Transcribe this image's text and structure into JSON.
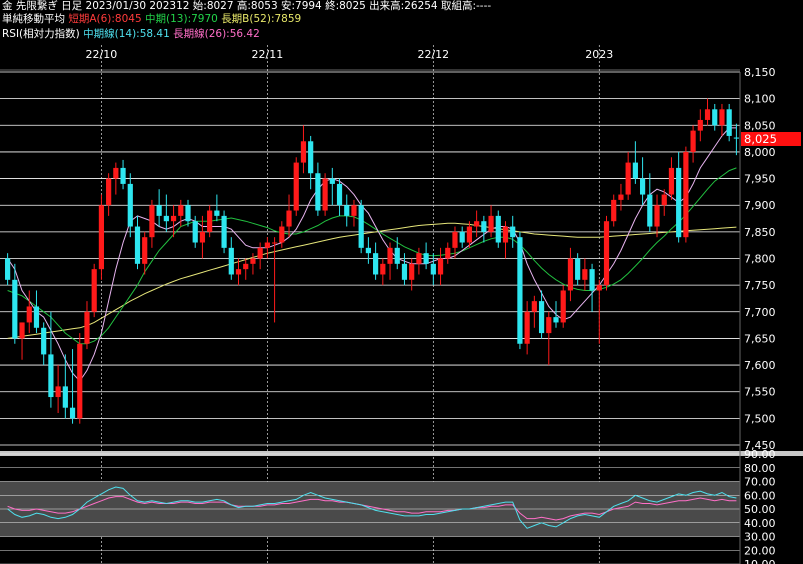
{
  "header": {
    "line1": "金 先限繋ぎ 日足 2023/01/30 202312 始:8027 高:8053 安:7994 終:8025 出来高:26254 取組高:----",
    "ma_title": "単純移動平均",
    "ma_short": "短期A(6):8045",
    "ma_mid": "中期(13):7970",
    "ma_long": "長期B(52):7859",
    "rsi_title": "RSI(相対力指数)",
    "rsi_mid": "中期線(14):58.41",
    "rsi_long": "長期線(26):56.42"
  },
  "current_price_label": "8,025",
  "colors": {
    "up": "#ff1a1a",
    "down": "#2ee6f0",
    "ma_short": "#e8b4f0",
    "ma_mid": "#22c040",
    "ma_long": "#e6e67a",
    "rsi_mid": "#4fe0ee",
    "rsi_long": "#ff6fc8",
    "grid": "#ffffff",
    "band": "#4a4a4a",
    "separator": "#c8c8c8",
    "price_badge": "#ff1010"
  },
  "chart_data": [
    {
      "type": "candlestick",
      "x_ticks": [
        "22/10",
        "22/11",
        "22/12",
        "2023"
      ],
      "x_tick_index": [
        13,
        36,
        59,
        82
      ],
      "ylim": [
        7450,
        8150
      ],
      "yticks": [
        7450,
        7500,
        7550,
        7600,
        7650,
        7700,
        7750,
        7800,
        7850,
        7900,
        7950,
        8000,
        8050,
        8100,
        8150
      ],
      "ytick_labels": [
        "7,450",
        "7,500",
        "7,550",
        "7,600",
        "7,650",
        "7,700",
        "7,750",
        "7,800",
        "7,850",
        "7,900",
        "7,950",
        "8,000",
        "8,050",
        "8,100",
        "8,150"
      ],
      "ohlc": [
        [
          7800,
          7810,
          7750,
          7760
        ],
        [
          7760,
          7790,
          7640,
          7650
        ],
        [
          7650,
          7680,
          7610,
          7680
        ],
        [
          7680,
          7740,
          7660,
          7710
        ],
        [
          7710,
          7740,
          7660,
          7670
        ],
        [
          7670,
          7680,
          7600,
          7620
        ],
        [
          7620,
          7700,
          7520,
          7540
        ],
        [
          7540,
          7600,
          7510,
          7560
        ],
        [
          7560,
          7620,
          7500,
          7520
        ],
        [
          7520,
          7630,
          7490,
          7500
        ],
        [
          7500,
          7660,
          7490,
          7640
        ],
        [
          7640,
          7720,
          7630,
          7700
        ],
        [
          7700,
          7790,
          7690,
          7780
        ],
        [
          7780,
          7920,
          7760,
          7900
        ],
        [
          7900,
          7960,
          7880,
          7950
        ],
        [
          7950,
          7980,
          7920,
          7970
        ],
        [
          7970,
          7985,
          7930,
          7940
        ],
        [
          7940,
          7960,
          7840,
          7860
        ],
        [
          7860,
          7880,
          7780,
          7790
        ],
        [
          7790,
          7850,
          7770,
          7840
        ],
        [
          7840,
          7910,
          7820,
          7900
        ],
        [
          7900,
          7930,
          7860,
          7880
        ],
        [
          7880,
          7920,
          7850,
          7870
        ],
        [
          7870,
          7900,
          7840,
          7880
        ],
        [
          7880,
          7910,
          7860,
          7900
        ],
        [
          7900,
          7910,
          7860,
          7870
        ],
        [
          7870,
          7880,
          7820,
          7830
        ],
        [
          7830,
          7880,
          7800,
          7850
        ],
        [
          7850,
          7900,
          7840,
          7890
        ],
        [
          7890,
          7920,
          7870,
          7880
        ],
        [
          7880,
          7890,
          7810,
          7820
        ],
        [
          7820,
          7840,
          7760,
          7770
        ],
        [
          7770,
          7800,
          7750,
          7780
        ],
        [
          7780,
          7800,
          7760,
          7790
        ],
        [
          7790,
          7810,
          7770,
          7800
        ],
        [
          7800,
          7830,
          7780,
          7820
        ],
        [
          7820,
          7840,
          7800,
          7830
        ],
        [
          7830,
          7840,
          7680,
          7830
        ],
        [
          7830,
          7870,
          7820,
          7860
        ],
        [
          7860,
          7920,
          7840,
          7890
        ],
        [
          7890,
          7990,
          7880,
          7980
        ],
        [
          7980,
          8050,
          7960,
          8020
        ],
        [
          8020,
          8030,
          7930,
          7960
        ],
        [
          7960,
          7980,
          7880,
          7890
        ],
        [
          7890,
          7960,
          7880,
          7950
        ],
        [
          7950,
          7970,
          7900,
          7940
        ],
        [
          7940,
          7950,
          7880,
          7900
        ],
        [
          7900,
          7920,
          7860,
          7880
        ],
        [
          7880,
          7910,
          7860,
          7900
        ],
        [
          7900,
          7910,
          7810,
          7820
        ],
        [
          7820,
          7840,
          7790,
          7810
        ],
        [
          7810,
          7830,
          7760,
          7770
        ],
        [
          7770,
          7800,
          7750,
          7790
        ],
        [
          7790,
          7830,
          7760,
          7820
        ],
        [
          7820,
          7840,
          7780,
          7790
        ],
        [
          7790,
          7810,
          7750,
          7760
        ],
        [
          7760,
          7800,
          7740,
          7790
        ],
        [
          7790,
          7820,
          7770,
          7810
        ],
        [
          7810,
          7830,
          7780,
          7790
        ],
        [
          7790,
          7810,
          7750,
          7770
        ],
        [
          7770,
          7820,
          7750,
          7800
        ],
        [
          7800,
          7830,
          7790,
          7820
        ],
        [
          7820,
          7860,
          7800,
          7850
        ],
        [
          7850,
          7860,
          7820,
          7830
        ],
        [
          7830,
          7870,
          7820,
          7860
        ],
        [
          7860,
          7890,
          7840,
          7870
        ],
        [
          7870,
          7880,
          7830,
          7850
        ],
        [
          7850,
          7900,
          7840,
          7880
        ],
        [
          7880,
          7890,
          7820,
          7830
        ],
        [
          7830,
          7870,
          7800,
          7860
        ],
        [
          7860,
          7880,
          7820,
          7840
        ],
        [
          7840,
          7850,
          7630,
          7640
        ],
        [
          7640,
          7720,
          7620,
          7700
        ],
        [
          7700,
          7730,
          7670,
          7720
        ],
        [
          7720,
          7740,
          7650,
          7660
        ],
        [
          7660,
          7700,
          7600,
          7690
        ],
        [
          7690,
          7720,
          7670,
          7680
        ],
        [
          7680,
          7750,
          7670,
          7740
        ],
        [
          7740,
          7820,
          7720,
          7800
        ],
        [
          7800,
          7810,
          7750,
          7760
        ],
        [
          7760,
          7800,
          7740,
          7780
        ],
        [
          7780,
          7790,
          7700,
          7740
        ],
        [
          7740,
          7760,
          7640,
          7750
        ],
        [
          7750,
          7880,
          7740,
          7870
        ],
        [
          7870,
          7920,
          7860,
          7910
        ],
        [
          7910,
          7940,
          7890,
          7920
        ],
        [
          7920,
          8000,
          7910,
          7980
        ],
        [
          7980,
          8020,
          7940,
          7950
        ],
        [
          7950,
          7990,
          7900,
          7920
        ],
        [
          7920,
          7960,
          7850,
          7860
        ],
        [
          7860,
          7920,
          7840,
          7900
        ],
        [
          7900,
          7930,
          7880,
          7920
        ],
        [
          7920,
          7990,
          7910,
          7970
        ],
        [
          7970,
          8000,
          7830,
          7840
        ],
        [
          7840,
          8010,
          7830,
          8000
        ],
        [
          8000,
          8050,
          7980,
          8040
        ],
        [
          8040,
          8080,
          8020,
          8060
        ],
        [
          8060,
          8100,
          8050,
          8080
        ],
        [
          8080,
          8090,
          8040,
          8050
        ],
        [
          8050,
          8090,
          8030,
          8080
        ],
        [
          8080,
          8090,
          8020,
          8030
        ],
        [
          8027,
          8053,
          7994,
          8025
        ]
      ],
      "ma_short": [
        7800,
        7780,
        7740,
        7720,
        7700,
        7690,
        7665,
        7640,
        7610,
        7585,
        7570,
        7590,
        7620,
        7660,
        7720,
        7780,
        7830,
        7870,
        7880,
        7875,
        7870,
        7860,
        7855,
        7860,
        7870,
        7875,
        7870,
        7860,
        7860,
        7860,
        7860,
        7855,
        7840,
        7825,
        7820,
        7820,
        7820,
        7825,
        7830,
        7840,
        7855,
        7880,
        7910,
        7930,
        7945,
        7950,
        7945,
        7935,
        7920,
        7900,
        7885,
        7860,
        7835,
        7815,
        7800,
        7795,
        7790,
        7790,
        7790,
        7795,
        7800,
        7800,
        7805,
        7815,
        7825,
        7835,
        7845,
        7855,
        7860,
        7860,
        7855,
        7830,
        7790,
        7760,
        7735,
        7710,
        7695,
        7685,
        7690,
        7705,
        7720,
        7735,
        7750,
        7770,
        7790,
        7815,
        7845,
        7875,
        7900,
        7920,
        7930,
        7925,
        7915,
        7905,
        7915,
        7940,
        7970,
        7990,
        8010,
        8030,
        8045,
        8045
      ],
      "ma_mid": [
        7740,
        7735,
        7730,
        7720,
        7710,
        7700,
        7690,
        7675,
        7660,
        7650,
        7640,
        7640,
        7645,
        7655,
        7670,
        7690,
        7710,
        7730,
        7750,
        7775,
        7795,
        7815,
        7830,
        7845,
        7860,
        7865,
        7870,
        7870,
        7870,
        7872,
        7874,
        7876,
        7873,
        7870,
        7866,
        7862,
        7858,
        7852,
        7848,
        7846,
        7846,
        7850,
        7856,
        7862,
        7870,
        7876,
        7880,
        7880,
        7878,
        7872,
        7864,
        7855,
        7846,
        7838,
        7830,
        7822,
        7816,
        7810,
        7806,
        7805,
        7806,
        7808,
        7810,
        7814,
        7820,
        7826,
        7832,
        7837,
        7840,
        7840,
        7836,
        7826,
        7812,
        7796,
        7782,
        7770,
        7760,
        7752,
        7746,
        7742,
        7740,
        7740,
        7742,
        7746,
        7752,
        7760,
        7772,
        7786,
        7800,
        7816,
        7830,
        7842,
        7856,
        7868,
        7882,
        7898,
        7914,
        7930,
        7945,
        7955,
        7965,
        7970
      ],
      "ma_long": [
        7650,
        7652,
        7654,
        7656,
        7658,
        7660,
        7662,
        7664,
        7666,
        7668,
        7670,
        7674,
        7680,
        7688,
        7696,
        7704,
        7712,
        7720,
        7727,
        7734,
        7740,
        7746,
        7752,
        7757,
        7762,
        7766,
        7770,
        7774,
        7778,
        7782,
        7786,
        7790,
        7794,
        7798,
        7802,
        7806,
        7810,
        7813,
        7816,
        7819,
        7822,
        7825,
        7828,
        7831,
        7834,
        7837,
        7840,
        7842,
        7844,
        7846,
        7848,
        7850,
        7852,
        7854,
        7856,
        7858,
        7860,
        7862,
        7863,
        7864,
        7865,
        7866,
        7866,
        7865,
        7864,
        7862,
        7860,
        7858,
        7856,
        7854,
        7852,
        7850,
        7848,
        7846,
        7845,
        7844,
        7843,
        7842,
        7841,
        7840,
        7840,
        7840,
        7840,
        7841,
        7842,
        7843,
        7844,
        7845,
        7846,
        7847,
        7848,
        7849,
        7850,
        7851,
        7852,
        7853,
        7854,
        7855,
        7856,
        7857,
        7858,
        7859
      ]
    },
    {
      "type": "line",
      "ylim": [
        10,
        90
      ],
      "yticks": [
        10,
        20,
        30,
        40,
        50,
        60,
        70,
        80,
        90
      ],
      "ytick_labels": [
        "10.00",
        "20.00",
        "30.00",
        "40.00",
        "50.00",
        "60.00",
        "70.00",
        "80.00",
        "90.00"
      ],
      "band": [
        30,
        70
      ],
      "series": [
        {
          "name": "中期線(14)",
          "values": [
            50,
            46,
            44,
            45,
            47,
            46,
            44,
            43,
            44,
            46,
            50,
            55,
            58,
            61,
            64,
            66,
            65,
            60,
            56,
            55,
            56,
            55,
            54,
            55,
            56,
            56,
            55,
            55,
            56,
            57,
            56,
            53,
            51,
            52,
            52,
            53,
            54,
            54,
            55,
            56,
            57,
            60,
            62,
            60,
            58,
            57,
            56,
            55,
            54,
            53,
            51,
            49,
            48,
            47,
            46,
            45,
            45,
            45,
            46,
            46,
            47,
            48,
            49,
            50,
            50,
            51,
            52,
            53,
            54,
            55,
            55,
            42,
            36,
            38,
            40,
            38,
            37,
            40,
            43,
            45,
            46,
            45,
            44,
            48,
            52,
            54,
            56,
            60,
            58,
            56,
            55,
            57,
            59,
            61,
            60,
            62,
            63,
            61,
            60,
            62,
            59,
            58
          ]
        },
        {
          "name": "長期線(26)",
          "values": [
            52,
            50,
            49,
            49,
            50,
            49,
            48,
            47,
            47,
            48,
            50,
            52,
            54,
            56,
            58,
            59,
            59,
            57,
            55,
            54,
            55,
            54,
            54,
            54,
            55,
            55,
            54,
            54,
            55,
            55,
            55,
            53,
            52,
            52,
            52,
            52,
            53,
            53,
            54,
            54,
            55,
            56,
            57,
            57,
            56,
            56,
            55,
            55,
            54,
            53,
            52,
            51,
            50,
            49,
            48,
            48,
            47,
            47,
            48,
            48,
            48,
            49,
            49,
            50,
            50,
            51,
            51,
            52,
            52,
            53,
            53,
            47,
            43,
            43,
            44,
            43,
            42,
            43,
            45,
            46,
            47,
            47,
            46,
            48,
            50,
            51,
            52,
            55,
            54,
            54,
            53,
            54,
            55,
            56,
            56,
            57,
            58,
            57,
            56,
            57,
            56,
            56
          ]
        }
      ]
    }
  ]
}
